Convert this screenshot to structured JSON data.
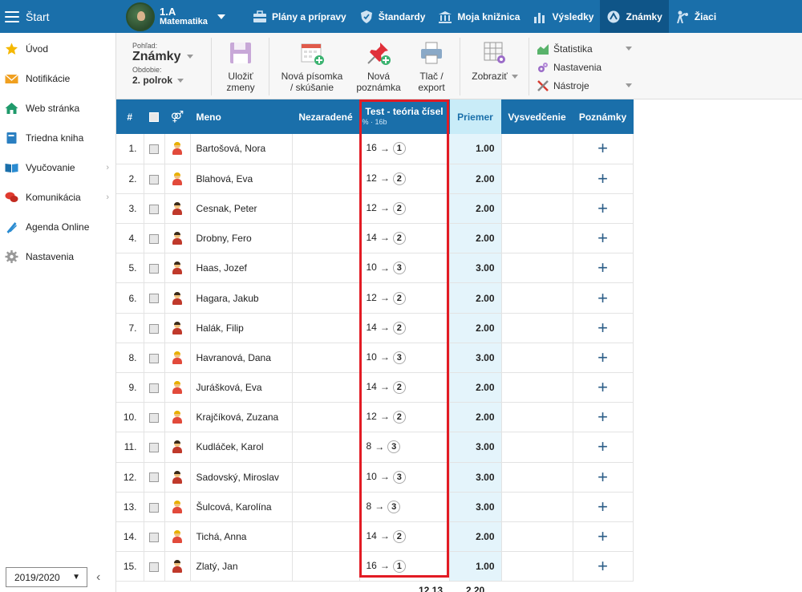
{
  "topbar": {
    "start_label": "Štart",
    "class_name": "1.A",
    "subject": "Matematika",
    "nav": [
      {
        "label": "Plány a prípravy",
        "icon": "briefcase-icon"
      },
      {
        "label": "Štandardy",
        "icon": "shield-icon"
      },
      {
        "label": "Moja knižnica",
        "icon": "library-icon"
      },
      {
        "label": "Výsledky",
        "icon": "bar-chart-icon"
      },
      {
        "label": "Známky",
        "icon": "grades-icon"
      },
      {
        "label": "Žiaci",
        "icon": "students-icon"
      }
    ]
  },
  "sidebar": {
    "items": [
      {
        "label": "Úvod",
        "icon": "star-icon"
      },
      {
        "label": "Notifikácie",
        "icon": "envelope-icon"
      },
      {
        "label": "Web stránka",
        "icon": "home-icon"
      },
      {
        "label": "Triedna kniha",
        "icon": "book-icon"
      },
      {
        "label": "Vyučovanie",
        "icon": "open-book-icon"
      },
      {
        "label": "Komunikácia",
        "icon": "chat-icon"
      },
      {
        "label": "Agenda Online",
        "icon": "pen-icon"
      },
      {
        "label": "Nastavenia",
        "icon": "gear-icon"
      }
    ],
    "year": "2019/2020"
  },
  "toolbar": {
    "view_label": "Pohľad:",
    "view_value": "Známky",
    "period_label": "Obdobie:",
    "period_value": "2. polrok",
    "save_l1": "Uložiť",
    "save_l2": "zmeny",
    "new_test_l1": "Nová písomka",
    "new_test_l2": "/ skúšanie",
    "new_note_l1": "Nová",
    "new_note_l2": "poznámka",
    "print_l1": "Tlač /",
    "print_l2": "export",
    "show_label": "Zobraziť",
    "statistics": "Štatistika",
    "settings": "Nastavenia",
    "tools": "Nástroje"
  },
  "grid": {
    "headers": {
      "num": "#",
      "name": "Meno",
      "unassigned": "Nezaradené",
      "test_title": "Test - teória čísel",
      "test_sub": "% · 16b",
      "average": "Priemer",
      "certificate": "Vysvedčenie",
      "notes": "Poznámky"
    },
    "rows": [
      {
        "num": "1.",
        "name": "Bartošová, Nora",
        "points": "16",
        "grade": "1",
        "avg": "1.00"
      },
      {
        "num": "2.",
        "name": "Blahová, Eva",
        "points": "12",
        "grade": "2",
        "avg": "2.00"
      },
      {
        "num": "3.",
        "name": "Cesnak, Peter",
        "points": "12",
        "grade": "2",
        "avg": "2.00"
      },
      {
        "num": "4.",
        "name": "Drobny, Fero",
        "points": "14",
        "grade": "2",
        "avg": "2.00"
      },
      {
        "num": "5.",
        "name": "Haas, Jozef",
        "points": "10",
        "grade": "3",
        "avg": "3.00"
      },
      {
        "num": "6.",
        "name": "Hagara, Jakub",
        "points": "12",
        "grade": "2",
        "avg": "2.00"
      },
      {
        "num": "7.",
        "name": "Halák, Filip",
        "points": "14",
        "grade": "2",
        "avg": "2.00"
      },
      {
        "num": "8.",
        "name": "Havranová, Dana",
        "points": "10",
        "grade": "3",
        "avg": "3.00"
      },
      {
        "num": "9.",
        "name": "Jurášková, Eva",
        "points": "14",
        "grade": "2",
        "avg": "2.00"
      },
      {
        "num": "10.",
        "name": "Krajčíková, Zuzana",
        "points": "12",
        "grade": "2",
        "avg": "2.00"
      },
      {
        "num": "11.",
        "name": "Kudláček, Karol",
        "points": "8",
        "grade": "3",
        "avg": "3.00"
      },
      {
        "num": "12.",
        "name": "Sadovský, Miroslav",
        "points": "10",
        "grade": "3",
        "avg": "3.00"
      },
      {
        "num": "13.",
        "name": "Šulcová, Karolína",
        "points": "8",
        "grade": "3",
        "avg": "3.00"
      },
      {
        "num": "14.",
        "name": "Tichá, Anna",
        "points": "14",
        "grade": "2",
        "avg": "2.00"
      },
      {
        "num": "15.",
        "name": "Zlatý, Jan",
        "points": "16",
        "grade": "1",
        "avg": "1.00"
      }
    ],
    "arrow": "→",
    "plus": "+",
    "footer_test": "12.13",
    "footer_avg": "2.20"
  },
  "colors": {
    "primary": "#1a6faa",
    "primary_dark": "#0f5588",
    "avg_bg": "#e4f4fb",
    "highlight": "#e21b24"
  }
}
